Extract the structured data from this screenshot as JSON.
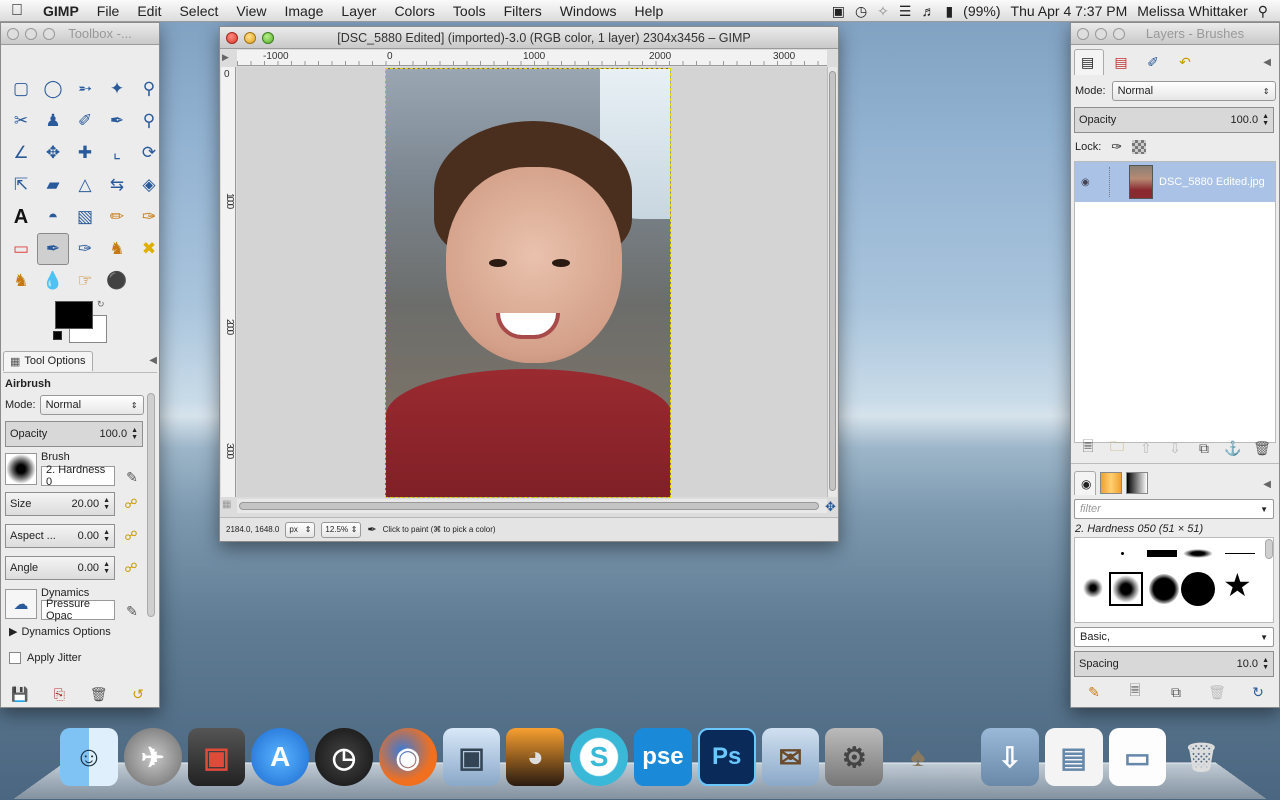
{
  "menubar": {
    "app": "GIMP",
    "items": [
      "File",
      "Edit",
      "Select",
      "View",
      "Image",
      "Layer",
      "Colors",
      "Tools",
      "Filters",
      "Windows",
      "Help"
    ],
    "battery": "(99%)",
    "datetime": "Thu Apr 4  7:37 PM",
    "user": "Melissa Whittaker"
  },
  "toolbox": {
    "title": "Toolbox -...",
    "tools": [
      "rect-select",
      "ellipse-select",
      "free-select",
      "fuzzy-select",
      "zoom",
      "scissors",
      "foreground-select",
      "paths",
      "color-picker",
      "magnify",
      "measure",
      "move",
      "align",
      "crop",
      "rotate",
      "scale",
      "shear",
      "perspective",
      "flip",
      "cage",
      "text",
      "bucket-fill",
      "blend",
      "pencil",
      "paintbrush",
      "eraser",
      "airbrush",
      "ink",
      "clone",
      "heal",
      "perspective-clone",
      "blur",
      "smudge",
      "dodge-burn"
    ],
    "active_tool_index": 26,
    "tool_options_tab": "Tool Options",
    "tool_name": "Airbrush",
    "mode_label": "Mode:",
    "mode_value": "Normal",
    "opacity_label": "Opacity",
    "opacity_value": "100.0",
    "brush_label": "Brush",
    "brush_value": "2. Hardness 0",
    "size_label": "Size",
    "size_value": "20.00",
    "aspect_label": "Aspect ...",
    "aspect_value": "0.00",
    "angle_label": "Angle",
    "angle_value": "0.00",
    "dynamics_label": "Dynamics",
    "dynamics_value": "Pressure Opac",
    "dynamics_options": "Dynamics Options",
    "apply_jitter": "Apply Jitter"
  },
  "image_window": {
    "title": "[DSC_5880 Edited] (imported)-3.0 (RGB color, 1 layer) 2304x3456 – GIMP",
    "ruler_h": [
      "-1000",
      "0",
      "1000",
      "2000",
      "3000"
    ],
    "ruler_v": [
      "0",
      "1000",
      "2000",
      "3000"
    ],
    "coords": "2184.0, 1648.0",
    "unit": "px",
    "zoom": "12.5%",
    "status_text": "Click to paint (⌘ to pick a color)"
  },
  "layers_dock": {
    "title": "Layers - Brushes",
    "mode_label": "Mode:",
    "mode_value": "Normal",
    "opacity_label": "Opacity",
    "opacity_value": "100.0",
    "lock_label": "Lock:",
    "layer_name": "DSC_5880 Edited.jpg",
    "filter_placeholder": "filter",
    "brush_name": "2. Hardness 050 (51 × 51)",
    "brush_tag": "Basic,",
    "spacing_label": "Spacing",
    "spacing_value": "10.0"
  },
  "dock": [
    "Finder",
    "Launchpad",
    "Photo Booth",
    "App Store",
    "Dashboard",
    "Firefox",
    "iPhoto",
    "Image Capture",
    "Skitch",
    "Photoshop Elements",
    "Photoshop",
    "Mail",
    "System Preferences",
    "GIMP",
    "Downloads",
    "Documents",
    "Desktop",
    "Trash"
  ],
  "colors": {
    "accent": "#3d73c8",
    "selection": "#a9c2e6",
    "fg": "#000000",
    "bg": "#ffffff"
  }
}
